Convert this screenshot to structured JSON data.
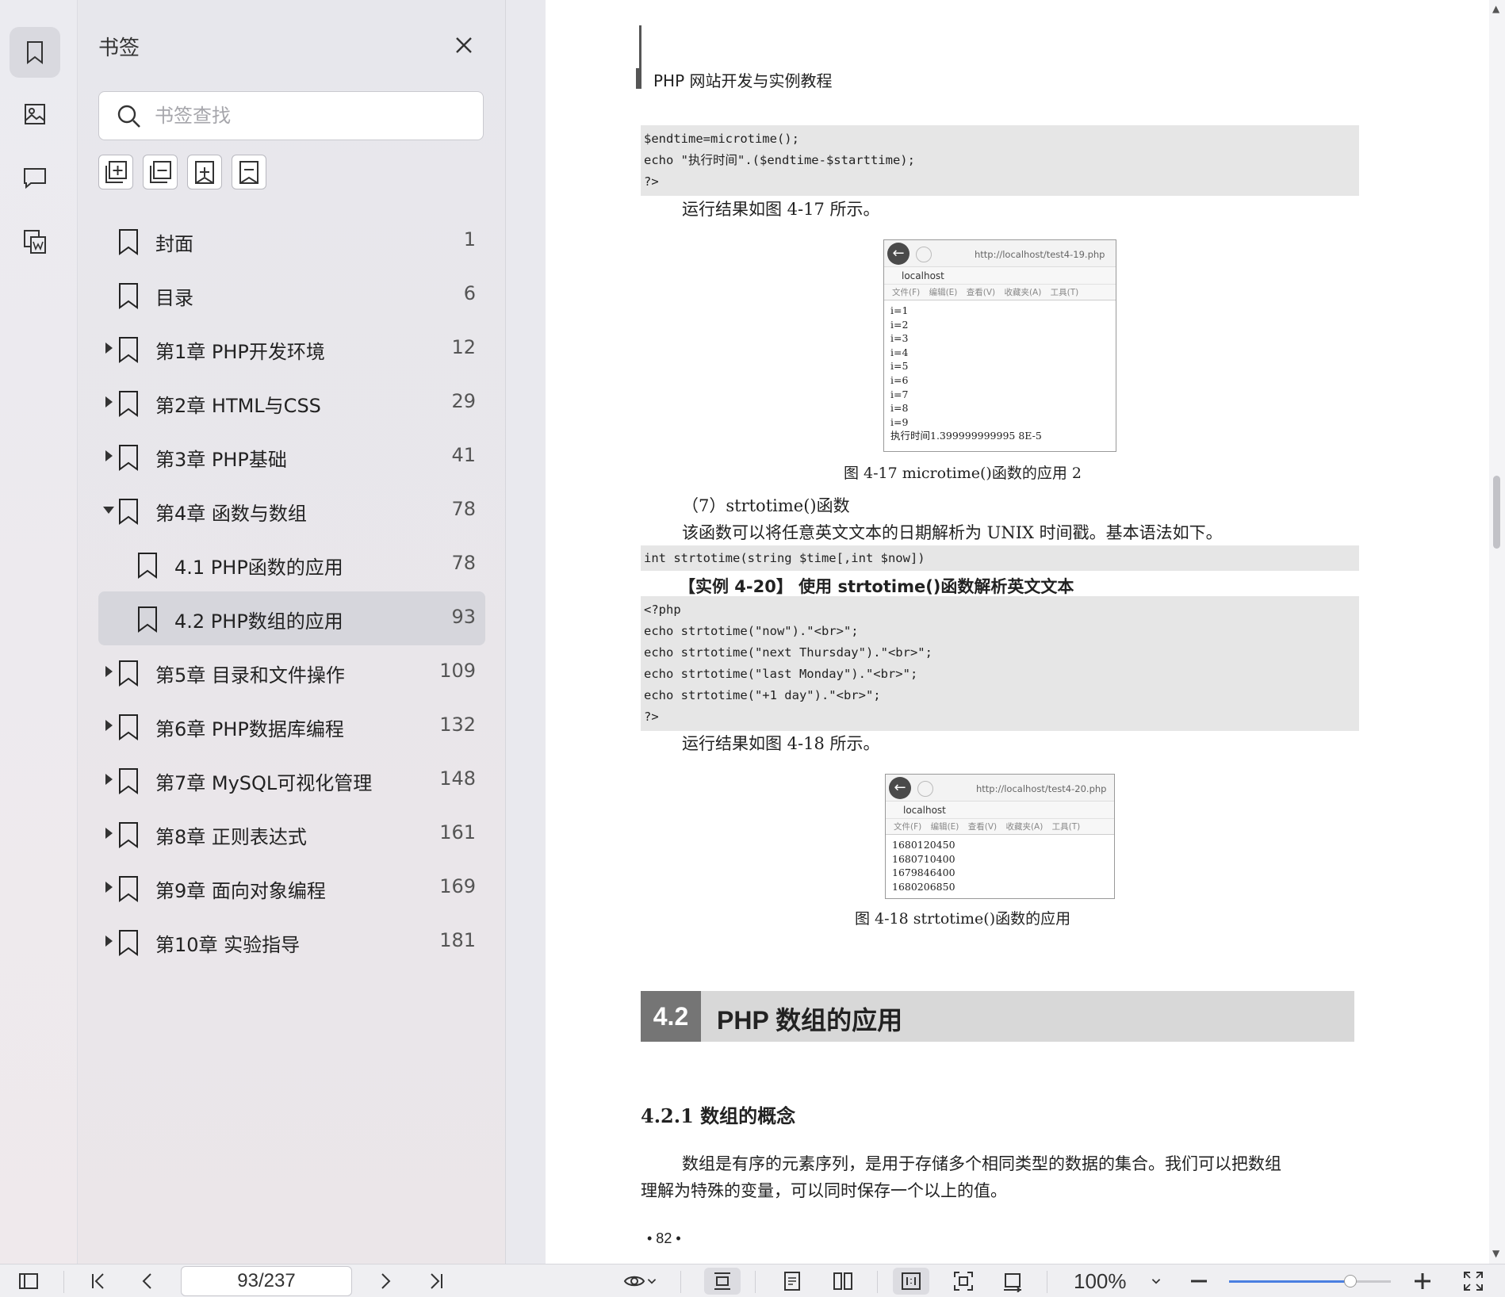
{
  "sidebar": {
    "title": "书签",
    "search_placeholder": "书签查找",
    "bookmarks": [
      {
        "label": "封面",
        "page": "1",
        "level": 0,
        "expandable": false
      },
      {
        "label": "目录",
        "page": "6",
        "level": 0,
        "expandable": false
      },
      {
        "label": "第1章 PHP开发环境",
        "page": "12",
        "level": 0,
        "expandable": true,
        "expanded": false
      },
      {
        "label": "第2章 HTML与CSS",
        "page": "29",
        "level": 0,
        "expandable": true,
        "expanded": false
      },
      {
        "label": "第3章 PHP基础",
        "page": "41",
        "level": 0,
        "expandable": true,
        "expanded": false
      },
      {
        "label": "第4章 函数与数组",
        "page": "78",
        "level": 0,
        "expandable": true,
        "expanded": true
      },
      {
        "label": "4.1 PHP函数的应用",
        "page": "78",
        "level": 1,
        "expandable": false
      },
      {
        "label": "4.2 PHP数组的应用",
        "page": "93",
        "level": 1,
        "expandable": false,
        "selected": true
      },
      {
        "label": "第5章 目录和文件操作",
        "page": "109",
        "level": 0,
        "expandable": true,
        "expanded": false
      },
      {
        "label": "第6章 PHP数据库编程",
        "page": "132",
        "level": 0,
        "expandable": true,
        "expanded": false
      },
      {
        "label": "第7章 MySQL可视化管理",
        "page": "148",
        "level": 0,
        "expandable": true,
        "expanded": false
      },
      {
        "label": "第8章 正则表达式",
        "page": "161",
        "level": 0,
        "expandable": true,
        "expanded": false
      },
      {
        "label": "第9章 面向对象编程",
        "page": "169",
        "level": 0,
        "expandable": true,
        "expanded": false
      },
      {
        "label": "第10章 实验指导",
        "page": "181",
        "level": 0,
        "expandable": true,
        "expanded": false
      }
    ]
  },
  "document": {
    "running_header": "PHP 网站开发与实例教程",
    "code1": "$endtime=microtime();\necho \"执行时间\".($endtime-$starttime);\n?>",
    "result_text1": "运行结果如图 4-17 所示。",
    "fig1": {
      "url": "http://localhost/test4-19.php",
      "tab": "localhost",
      "menu": "文件(F) 编辑(E) 查看(V) 收藏夹(A) 工具(T)",
      "output": "i=1\ni=2\ni=3\ni=4\ni=5\ni=6\ni=7\ni=8\ni=9\n执行时间1.399999999995 8E-5",
      "caption": "图 4-17    microtime()函数的应用 2"
    },
    "item7_title": "（7）strtotime()函数",
    "item7_desc": "该函数可以将任意英文文本的日期解析为 UNIX 时间戳。基本语法如下。",
    "syntax": "int strtotime(string $time[,int $now])",
    "example_title": "【实例 4-20】   使用 strtotime()函数解析英文文本",
    "code2": "<?php\necho strtotime(\"now\").\"<br>\";\necho strtotime(\"next Thursday\").\"<br>\";\necho strtotime(\"last Monday\").\"<br>\";\necho strtotime(\"+1 day\").\"<br>\";\n?>",
    "result_text2": "运行结果如图 4-18 所示。",
    "fig2": {
      "url": "http://localhost/test4-20.php",
      "tab": "localhost",
      "menu": "文件(F) 编辑(E) 查看(V) 收藏夹(A) 工具(T)",
      "output": "1680120450\n1680710400\n1679846400\n1680206850",
      "caption": "图 4-18    strtotime()函数的应用"
    },
    "section_num": "4.2",
    "section_title": "PHP 数组的应用",
    "subsection": "4.2.1    数组的概念",
    "para_line1": "数组是有序的元素序列，是用于存储多个相同类型的数据的集合。我们可以把数组",
    "para_line2": "理解为特殊的变量，可以同时保存一个以上的值。",
    "page_number": "• 82 •"
  },
  "toolbar": {
    "page_indicator": "93/237",
    "zoom": "100%",
    "zoom_level": 0.75
  }
}
